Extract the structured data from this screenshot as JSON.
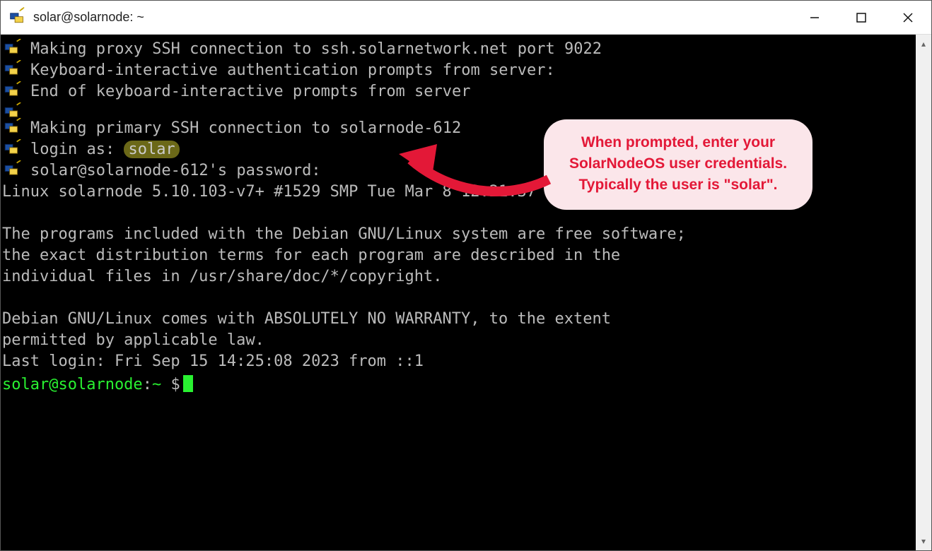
{
  "window": {
    "title": "solar@solarnode: ~"
  },
  "terminal": {
    "lines_with_icon": [
      "Making proxy SSH connection to ssh.solarnetwork.net port 9022",
      "Keyboard-interactive authentication prompts from server:",
      "End of keyboard-interactive prompts from server",
      "",
      "Making primary SSH connection to solarnode-612"
    ],
    "login_prefix": "login as: ",
    "login_user": "solar",
    "password_line": "solar@solarnode-612's password:",
    "body_lines": [
      "Linux solarnode 5.10.103-v7+ #1529 SMP Tue Mar 8 12:21:37 GMT 2022 armv7l",
      "",
      "The programs included with the Debian GNU/Linux system are free software;",
      "the exact distribution terms for each program are described in the",
      "individual files in /usr/share/doc/*/copyright.",
      "",
      "Debian GNU/Linux comes with ABSOLUTELY NO WARRANTY, to the extent",
      "permitted by applicable law.",
      "Last login: Fri Sep 15 14:25:08 2023 from ::1"
    ],
    "prompt_user_host": "solar@solarnode",
    "prompt_sep": ":",
    "prompt_path": "~ ",
    "prompt_symbol": "$"
  },
  "callout": {
    "line1": "When prompted, enter your",
    "line2": "SolarNodeOS user credentials.",
    "line3": "Typically the user is \"solar\"."
  }
}
